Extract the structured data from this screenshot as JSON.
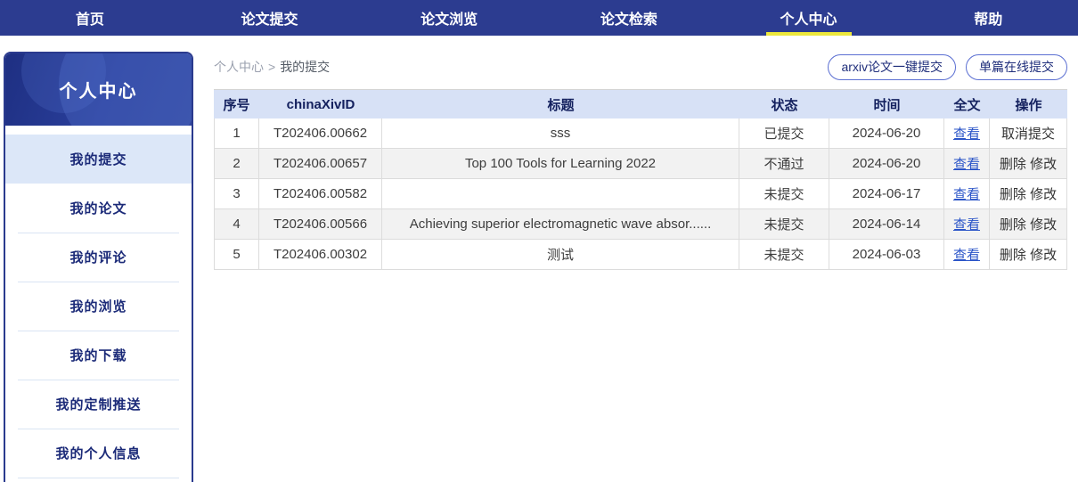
{
  "nav": {
    "items": [
      {
        "label": "首页",
        "active": false
      },
      {
        "label": "论文提交",
        "active": false
      },
      {
        "label": "论文浏览",
        "active": false
      },
      {
        "label": "论文检索",
        "active": false
      },
      {
        "label": "个人中心",
        "active": true
      },
      {
        "label": "帮助",
        "active": false
      }
    ]
  },
  "sidebar": {
    "title": "个人中心",
    "items": [
      {
        "label": "我的提交",
        "active": true
      },
      {
        "label": "我的论文",
        "active": false
      },
      {
        "label": "我的评论",
        "active": false
      },
      {
        "label": "我的浏览",
        "active": false
      },
      {
        "label": "我的下载",
        "active": false
      },
      {
        "label": "我的定制推送",
        "active": false
      },
      {
        "label": "我的个人信息",
        "active": false
      }
    ]
  },
  "breadcrumb": {
    "parent": "个人中心",
    "separator": ">",
    "current": "我的提交"
  },
  "actions": {
    "arxiv_batch_submit": "arxiv论文一键提交",
    "single_online_submit": "单篇在线提交"
  },
  "table": {
    "headers": [
      "序号",
      "chinaXivID",
      "标题",
      "状态",
      "时间",
      "全文",
      "操作"
    ],
    "rows": [
      {
        "index": "1",
        "id": "T202406.00662",
        "title": "sss",
        "status": "已提交",
        "date": "2024-06-20",
        "fulltext": "查看",
        "op1": "取消提交",
        "op2": ""
      },
      {
        "index": "2",
        "id": "T202406.00657",
        "title": "Top 100 Tools for Learning 2022",
        "status": "不通过",
        "date": "2024-06-20",
        "fulltext": "查看",
        "op1": "删除",
        "op2": "修改"
      },
      {
        "index": "3",
        "id": "T202406.00582",
        "title": "",
        "status": "未提交",
        "date": "2024-06-17",
        "fulltext": "查看",
        "op1": "删除",
        "op2": "修改"
      },
      {
        "index": "4",
        "id": "T202406.00566",
        "title": "Achieving superior electromagnetic wave absor......",
        "status": "未提交",
        "date": "2024-06-14",
        "fulltext": "查看",
        "op1": "删除",
        "op2": "修改"
      },
      {
        "index": "5",
        "id": "T202406.00302",
        "title": "测试",
        "status": "未提交",
        "date": "2024-06-03",
        "fulltext": "查看",
        "op1": "删除",
        "op2": "修改"
      }
    ]
  },
  "colors": {
    "nav_bg": "#2c3c90",
    "nav_active_underline": "#ece73c",
    "sidebar_border": "#2a3a8e",
    "sidebar_header_bg": "#2a3f9b",
    "sidebar_item_text": "#1b2a78",
    "sidebar_active_bg": "#dce7f8",
    "table_header_bg": "#d7e1f6",
    "table_header_text": "#13205e",
    "row_stripe": "#f2f2f2",
    "link_blue": "#2b55c8",
    "button_border": "#5b6fd2"
  }
}
